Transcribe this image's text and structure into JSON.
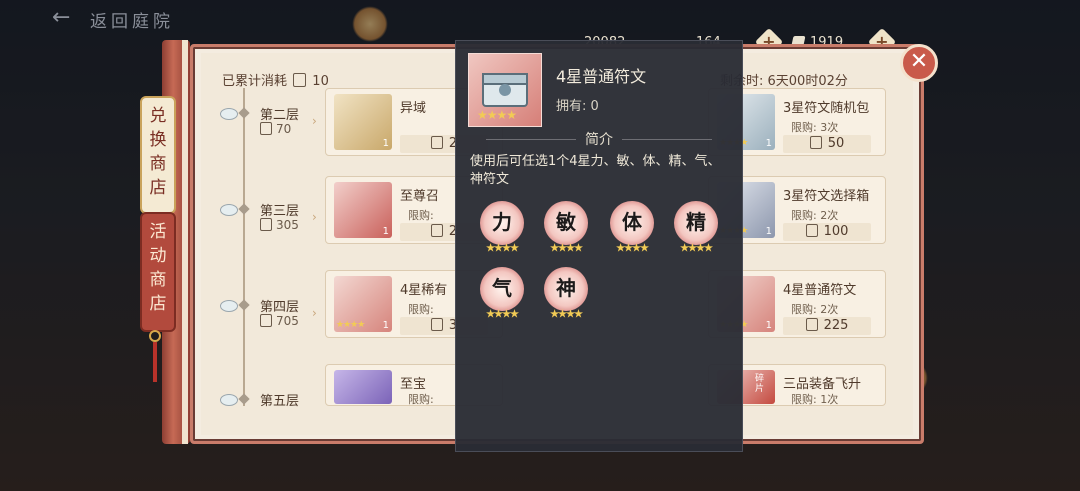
{
  "top": {
    "back_label": "←",
    "title": "返回庭院",
    "resource_1": "20082",
    "resource_2": "164",
    "resource_3": "1919",
    "plus_label": "+"
  },
  "tabs": {
    "exchange": "兑换商店",
    "activity": "活动商店"
  },
  "header": {
    "accumulated_label": "已累计消耗",
    "accumulated_value": "10",
    "timer": "剩余时: 6天00时02分"
  },
  "floors": [
    {
      "name": "第二层",
      "cost": "70"
    },
    {
      "name": "第三层",
      "cost": "305"
    },
    {
      "name": "第四层",
      "cost": "705"
    },
    {
      "name": "第五层",
      "cost": ""
    }
  ],
  "cards": {
    "c1": {
      "name": "异域",
      "limit": "",
      "price": "2",
      "qty": "1"
    },
    "c2": {
      "name": "3星符文随机包",
      "limit": "限购: 3次",
      "price": "50",
      "qty": "1"
    },
    "c3": {
      "name": "至尊召",
      "limit": "限购:",
      "price": "2",
      "qty": "1"
    },
    "c4": {
      "name": "3星符文选择箱",
      "limit": "限购: 2次",
      "price": "100",
      "qty": "1"
    },
    "c5": {
      "name": "4星稀有",
      "limit": "限购:",
      "price": "3",
      "qty": "1"
    },
    "c6": {
      "name": "4星普通符文",
      "limit": "限购: 2次",
      "price": "225",
      "qty": "1"
    },
    "c7": {
      "name": "至宝",
      "limit": "限购:",
      "price": "",
      "qty": ""
    },
    "c8": {
      "name": "三品装备飞升",
      "limit": "限购: 1次",
      "price": "",
      "qty": "",
      "badge": "碎片"
    }
  },
  "popup": {
    "item_name": "4星普通符文",
    "owned": "拥有: 0",
    "section": "简介",
    "description": "使用后可任选1个4星力、敏、体、精、气、神符文",
    "runes": [
      "力",
      "敏",
      "体",
      "精",
      "气",
      "神"
    ],
    "stars": "★★★★"
  },
  "close_label": "✕"
}
